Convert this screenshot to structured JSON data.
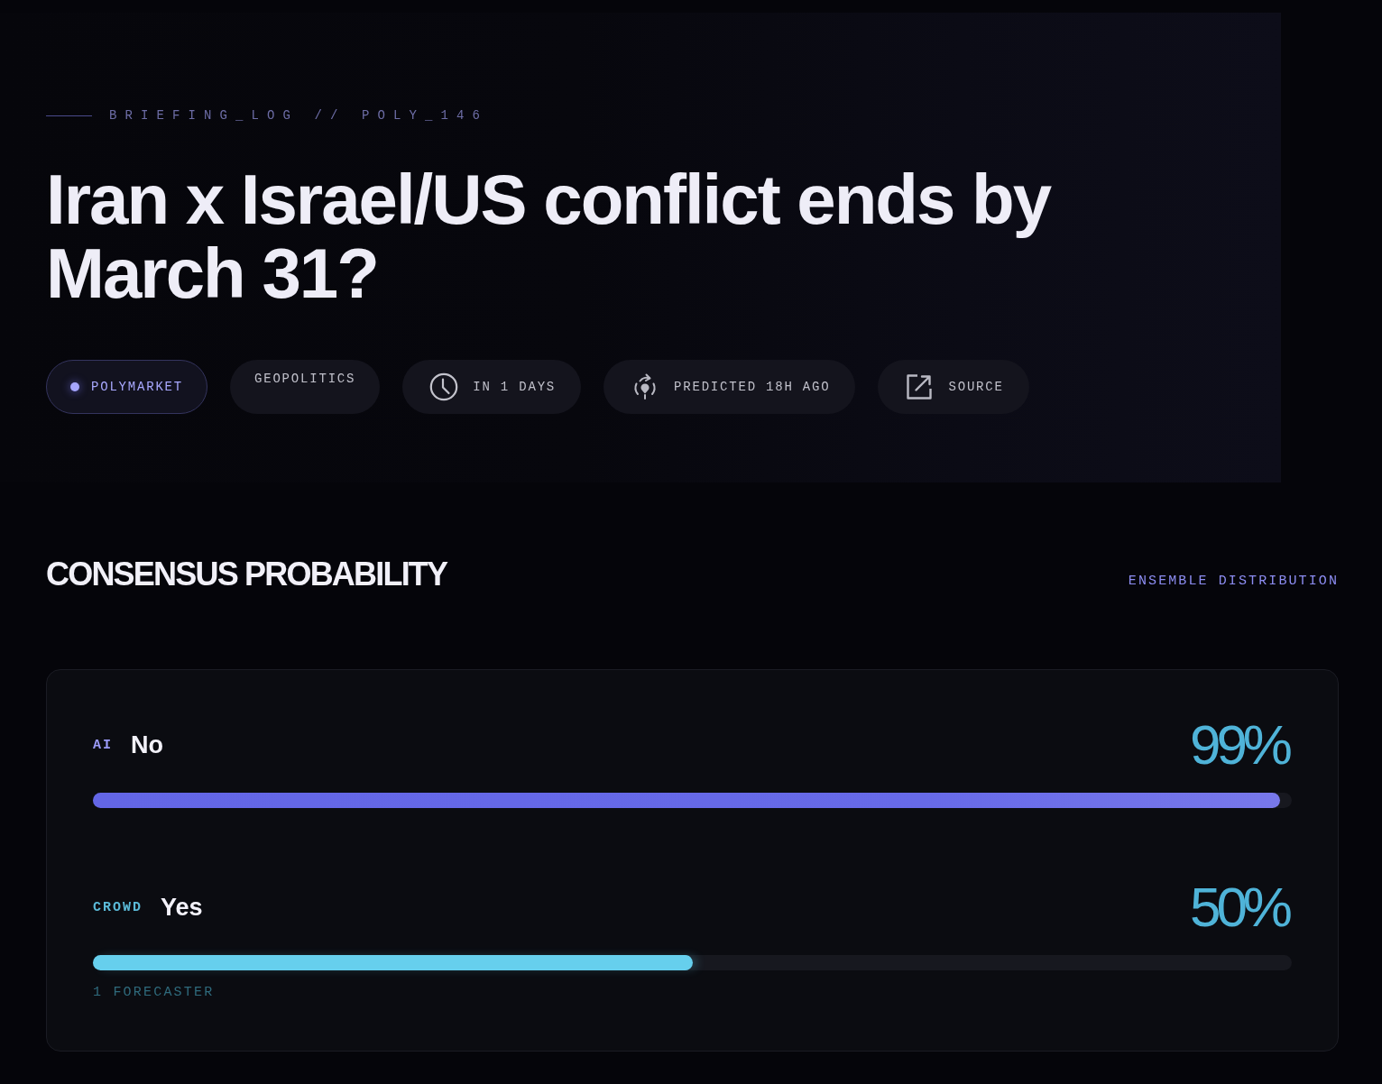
{
  "header": {
    "eyebrow": "BRIEFING_LOG // POLY_146",
    "title": "Iran x Israel/US conflict ends by March 31?"
  },
  "chips": [
    {
      "kind": "platform",
      "label": "POLYMARKET"
    },
    {
      "kind": "category",
      "label": "GEOPOLITICS"
    },
    {
      "kind": "deadline",
      "label": "IN 1 DAYS"
    },
    {
      "kind": "predicted",
      "label": "PREDICTED 18H AGO"
    },
    {
      "kind": "source",
      "label": "SOURCE"
    }
  ],
  "consensus": {
    "title": "CONSENSUS PROBABILITY",
    "subtitle": "ENSEMBLE DISTRIBUTION",
    "rows": [
      {
        "kind": "ai",
        "tag": "AI",
        "outcome": "No",
        "percent": "99%",
        "level": 0.99
      },
      {
        "kind": "crowd",
        "tag": "CROWD",
        "outcome": "Yes",
        "percent": "50%",
        "level": 0.5,
        "note": "1 FORECASTER"
      }
    ]
  }
}
